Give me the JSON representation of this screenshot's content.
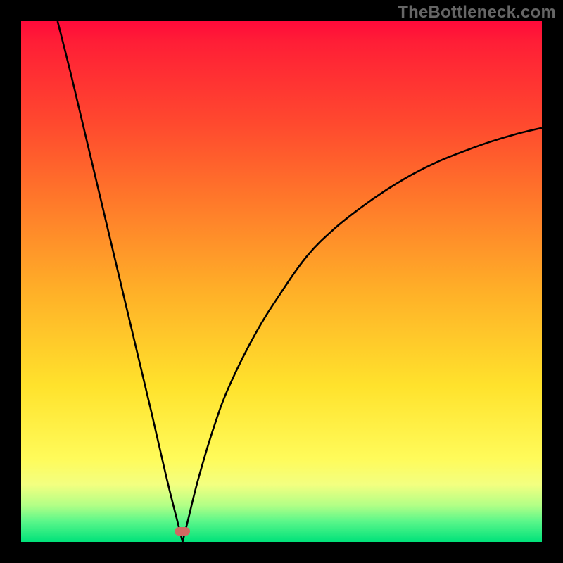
{
  "watermark": "TheBottleneck.com",
  "chart_data": {
    "type": "line",
    "title": "",
    "xlabel": "",
    "ylabel": "",
    "xlim": [
      0,
      100
    ],
    "ylim": [
      0,
      100
    ],
    "grid": false,
    "legend": false,
    "background": {
      "gradient_direction": "vertical",
      "stops": [
        {
          "pos": 0,
          "color": "#ff0a3a"
        },
        {
          "pos": 20,
          "color": "#ff4a2e"
        },
        {
          "pos": 35,
          "color": "#ff7a2a"
        },
        {
          "pos": 52,
          "color": "#ffb028"
        },
        {
          "pos": 70,
          "color": "#ffe22c"
        },
        {
          "pos": 84,
          "color": "#fffb5a"
        },
        {
          "pos": 89,
          "color": "#f3ff80"
        },
        {
          "pos": 93,
          "color": "#b2ff86"
        },
        {
          "pos": 96,
          "color": "#5cf78a"
        },
        {
          "pos": 100,
          "color": "#00e27a"
        }
      ]
    },
    "series": [
      {
        "name": "left-branch",
        "x": [
          7,
          10,
          15,
          20,
          25,
          28,
          30,
          31
        ],
        "y": [
          100,
          88,
          67,
          46,
          25,
          12,
          4,
          0
        ]
      },
      {
        "name": "right-branch",
        "x": [
          31,
          32,
          34,
          37,
          40,
          45,
          50,
          55,
          60,
          65,
          70,
          75,
          80,
          85,
          90,
          95,
          100
        ],
        "y": [
          0,
          4,
          12,
          22,
          30,
          40,
          48,
          55,
          60,
          64,
          67.5,
          70.5,
          73,
          75,
          76.8,
          78.3,
          79.5
        ]
      }
    ],
    "marker": {
      "x": 31,
      "y": 2,
      "color": "#cf6a62",
      "shape": "pill"
    },
    "notes": "V-shaped bottleneck curve on a thermal gradient background; vertex near x≈31 at y≈0; left edge starts at top-left corner, right edge asymptotes toward ~80% height at the right side."
  }
}
